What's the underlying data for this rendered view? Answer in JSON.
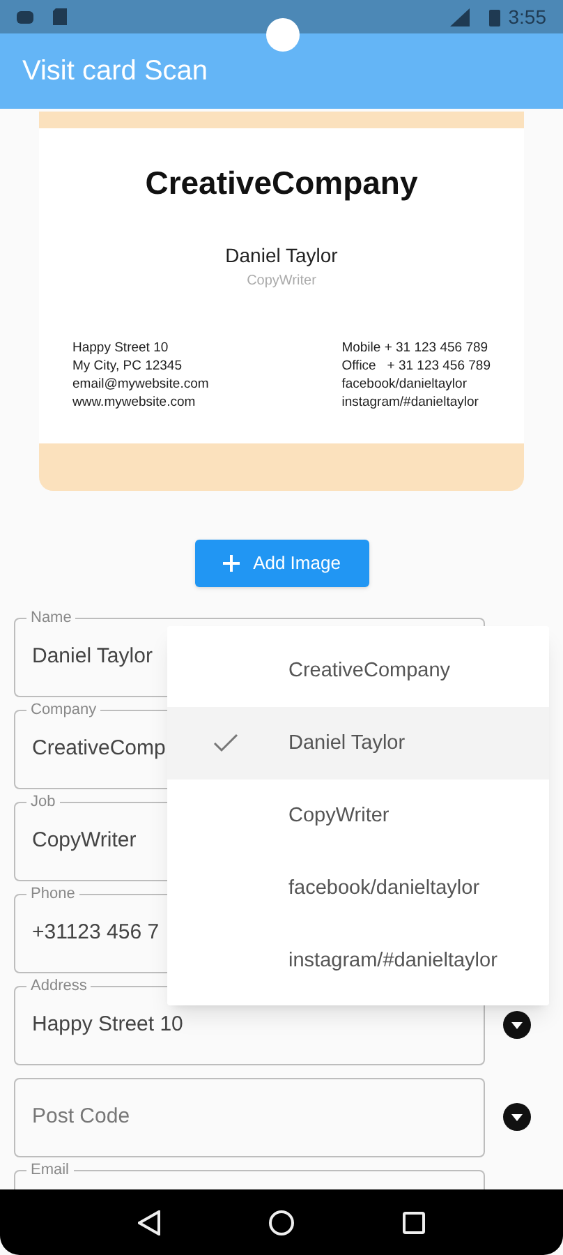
{
  "status_bar": {
    "time": "3:55"
  },
  "app_bar": {
    "title": "Visit card Scan"
  },
  "card": {
    "company": "CreativeCompany",
    "name": "Daniel Taylor",
    "job": "CopyWriter",
    "left_lines": [
      "Happy Street 10",
      "My City, PC 12345",
      "email@mywebsite.com",
      "www.mywebsite.com"
    ],
    "right_lines": [
      "Mobile + 31 123 456 789",
      "Office   + 31 123 456 789",
      "facebook/danieltaylor",
      "instagram/#danieltaylor"
    ]
  },
  "add_button": {
    "label": "Add Image"
  },
  "fields": [
    {
      "label": "Name",
      "value": "Daniel Taylor"
    },
    {
      "label": "Company",
      "value": "CreativeComp"
    },
    {
      "label": "Job",
      "value": "CopyWriter"
    },
    {
      "label": "Phone",
      "value": "+31123 456 7"
    },
    {
      "label": "Address",
      "value": "Happy Street 10",
      "dropdown": true
    },
    {
      "placeholder": "Post Code",
      "dropdown": true
    },
    {
      "label": "Email"
    }
  ],
  "menu": {
    "items": [
      {
        "label": "CreativeCompany",
        "selected": false
      },
      {
        "label": "Daniel Taylor",
        "selected": true
      },
      {
        "label": "CopyWriter",
        "selected": false
      },
      {
        "label": "facebook/danieltaylor",
        "selected": false
      },
      {
        "label": "instagram/#danieltaylor",
        "selected": false
      }
    ]
  }
}
